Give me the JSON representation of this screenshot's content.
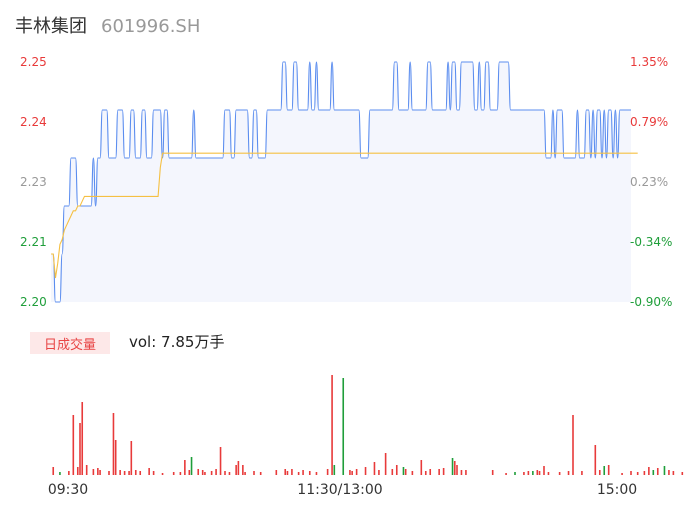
{
  "header": {
    "name": "丰林集团",
    "code": "601996.SH"
  },
  "volume_panel": {
    "tag": "日成交量",
    "label": "vol: 7.85万手"
  },
  "colors": {
    "price_line": "#5b8def",
    "avg_line": "#f5c043",
    "area_fill": "#f4f6fd",
    "up": "#e83a3a",
    "down": "#1f9e3a",
    "neutral": "#999999",
    "volume_up": "#f07878"
  },
  "chart_data": [
    {
      "type": "line",
      "title": "",
      "y_ticks_left": [
        "2.25",
        "2.24",
        "2.23",
        "2.21",
        "2.20"
      ],
      "y_ticks_right": [
        "1.35%",
        "0.79%",
        "0.23%",
        "-0.34%",
        "-0.90%"
      ],
      "ylim": [
        2.2,
        2.25
      ],
      "x_ticks": [
        "09:30",
        "11:30/13:00",
        "15:00"
      ],
      "series": [
        {
          "key": "price",
          "values": [
            2.21,
            2.21,
            2.2,
            2.2,
            2.2,
            2.21,
            2.22,
            2.22,
            2.22,
            2.23,
            2.23,
            2.23,
            2.22,
            2.22,
            2.22,
            2.22,
            2.22,
            2.22,
            2.22,
            2.23,
            2.22,
            2.23,
            2.23,
            2.24,
            2.24,
            2.24,
            2.23,
            2.23,
            2.23,
            2.23,
            2.24,
            2.24,
            2.24,
            2.23,
            2.23,
            2.23,
            2.24,
            2.24,
            2.23,
            2.23,
            2.23,
            2.24,
            2.24,
            2.23,
            2.23,
            2.23,
            2.24,
            2.24,
            2.24,
            2.24,
            2.23,
            2.24,
            2.24,
            2.23,
            2.23,
            2.23,
            2.23,
            2.23,
            2.23,
            2.23,
            2.23,
            2.23,
            2.23,
            2.23,
            2.24,
            2.23,
            2.23,
            2.23,
            2.23,
            2.23,
            2.23,
            2.23,
            2.23,
            2.23,
            2.23,
            2.23,
            2.23,
            2.23,
            2.24,
            2.24,
            2.24,
            2.23,
            2.23,
            2.24,
            2.24,
            2.24,
            2.24,
            2.24,
            2.24,
            2.23,
            2.23,
            2.24,
            2.24,
            2.23,
            2.23,
            2.23,
            2.23,
            2.24,
            2.24,
            2.24,
            2.24,
            2.24,
            2.24,
            2.24,
            2.25,
            2.25,
            2.24,
            2.24,
            2.24,
            2.25,
            2.25,
            2.24,
            2.24,
            2.24,
            2.24,
            2.24,
            2.25,
            2.24,
            2.24,
            2.25,
            2.24,
            2.24,
            2.24,
            2.24,
            2.24,
            2.24,
            2.25,
            2.24,
            2.24,
            2.24,
            2.24,
            2.24,
            2.24,
            2.24,
            2.24,
            2.24,
            2.24,
            2.24,
            2.24,
            2.23,
            2.23,
            2.23,
            2.23,
            2.24,
            2.24,
            2.24,
            2.24,
            2.24,
            2.24,
            2.24,
            2.24,
            2.24,
            2.24,
            2.24,
            2.25,
            2.25,
            2.24,
            2.24,
            2.24,
            2.24,
            2.24,
            2.25,
            2.24,
            2.24,
            2.24,
            2.24,
            2.24,
            2.24,
            2.24,
            2.25,
            2.25,
            2.24,
            2.24,
            2.24,
            2.24,
            2.24,
            2.24,
            2.24,
            2.25,
            2.24,
            2.25,
            2.25,
            2.24,
            2.24,
            2.25,
            2.25,
            2.25,
            2.25,
            2.25,
            2.25,
            2.24,
            2.24,
            2.25,
            2.24,
            2.24,
            2.25,
            2.25,
            2.24,
            2.24,
            2.24,
            2.24,
            2.25,
            2.25,
            2.25,
            2.25,
            2.25,
            2.24,
            2.24,
            2.24,
            2.24,
            2.24,
            2.24,
            2.24,
            2.24,
            2.24,
            2.24,
            2.24,
            2.24,
            2.24,
            2.24,
            2.24,
            2.24,
            2.23,
            2.23,
            2.23,
            2.24,
            2.23,
            2.24,
            2.24,
            2.24,
            2.23,
            2.23,
            2.23,
            2.23,
            2.23,
            2.23,
            2.24,
            2.23,
            2.23,
            2.23,
            2.24,
            2.24,
            2.23,
            2.24,
            2.23,
            2.24,
            2.24,
            2.23,
            2.24,
            2.23,
            2.24,
            2.24,
            2.23,
            2.24,
            2.23,
            2.24,
            2.24,
            2.24,
            2.24,
            2.24,
            2.24
          ]
        },
        {
          "key": "average",
          "values": [
            2.21,
            2.21,
            2.205,
            2.208,
            2.212,
            2.213,
            2.215,
            2.216,
            2.217,
            2.218,
            2.219,
            2.219,
            2.22,
            2.22,
            2.221,
            2.222,
            2.222,
            2.222,
            2.222,
            2.222,
            2.222,
            2.222,
            2.222,
            2.222,
            2.222,
            2.222,
            2.222,
            2.222,
            2.222,
            2.222,
            2.222,
            2.222,
            2.222,
            2.222,
            2.222,
            2.222,
            2.222,
            2.222,
            2.222,
            2.222,
            2.222,
            2.222,
            2.222,
            2.222,
            2.222,
            2.222,
            2.222,
            2.222,
            2.222,
            2.228,
            2.231,
            2.231,
            2.231,
            2.231,
            2.231,
            2.231,
            2.231,
            2.231,
            2.231,
            2.231,
            2.231,
            2.231,
            2.231,
            2.231,
            2.231,
            2.231,
            2.231,
            2.231,
            2.231,
            2.231,
            2.231,
            2.231,
            2.231,
            2.231,
            2.231,
            2.231,
            2.231,
            2.231,
            2.231,
            2.231,
            2.231,
            2.231,
            2.231,
            2.231,
            2.231,
            2.231,
            2.231,
            2.231,
            2.231,
            2.231,
            2.231,
            2.231,
            2.231,
            2.231,
            2.231,
            2.231,
            2.231,
            2.231,
            2.231,
            2.231,
            2.231,
            2.231,
            2.231,
            2.231,
            2.231,
            2.231,
            2.231,
            2.231,
            2.231,
            2.231,
            2.231,
            2.231,
            2.231,
            2.231,
            2.231,
            2.231,
            2.231,
            2.231,
            2.231,
            2.231,
            2.231,
            2.231,
            2.231,
            2.231,
            2.231,
            2.231,
            2.231,
            2.231,
            2.231,
            2.231,
            2.231,
            2.231,
            2.231,
            2.231,
            2.231,
            2.231,
            2.231,
            2.231,
            2.231,
            2.231,
            2.231,
            2.231,
            2.231,
            2.231,
            2.231,
            2.231,
            2.231,
            2.231,
            2.231,
            2.231,
            2.231,
            2.231,
            2.231,
            2.231,
            2.231,
            2.231,
            2.231,
            2.231,
            2.231,
            2.231,
            2.231,
            2.231,
            2.231,
            2.231,
            2.231,
            2.231,
            2.231,
            2.231,
            2.231,
            2.231,
            2.231,
            2.231,
            2.231,
            2.231,
            2.231,
            2.231,
            2.231,
            2.231,
            2.231,
            2.231,
            2.231,
            2.231,
            2.231,
            2.231,
            2.231,
            2.231,
            2.231,
            2.231,
            2.231,
            2.231,
            2.231,
            2.231,
            2.231,
            2.231,
            2.231,
            2.231,
            2.231,
            2.231,
            2.231,
            2.231,
            2.231,
            2.231,
            2.231,
            2.231,
            2.231,
            2.231,
            2.231,
            2.231,
            2.231,
            2.231,
            2.231,
            2.231,
            2.231,
            2.231,
            2.231,
            2.231,
            2.231,
            2.231,
            2.231,
            2.231,
            2.231,
            2.231,
            2.231,
            2.231,
            2.231,
            2.231,
            2.231,
            2.231,
            2.231,
            2.231,
            2.231,
            2.231,
            2.231,
            2.231,
            2.231,
            2.231,
            2.231,
            2.231,
            2.231,
            2.231,
            2.231,
            2.231,
            2.231,
            2.231,
            2.231,
            2.231,
            2.231,
            2.231,
            2.231,
            2.231,
            2.231,
            2.231,
            2.231,
            2.231,
            2.231,
            2.231,
            2.231,
            2.231,
            2.231,
            2.231,
            2.231,
            2.231,
            2.231,
            2.231
          ]
        }
      ]
    },
    {
      "type": "bar",
      "title": "",
      "volumes": [
        {
          "i": 1,
          "v": 8,
          "c": "up"
        },
        {
          "i": 4,
          "v": 3,
          "c": "down"
        },
        {
          "i": 8,
          "v": 4,
          "c": "up"
        },
        {
          "i": 10,
          "v": 60,
          "c": "up"
        },
        {
          "i": 12,
          "v": 8,
          "c": "up"
        },
        {
          "i": 13,
          "v": 52,
          "c": "up"
        },
        {
          "i": 14,
          "v": 73,
          "c": "up"
        },
        {
          "i": 16,
          "v": 10,
          "c": "up"
        },
        {
          "i": 19,
          "v": 6,
          "c": "up"
        },
        {
          "i": 21,
          "v": 7,
          "c": "up"
        },
        {
          "i": 22,
          "v": 5,
          "c": "up"
        },
        {
          "i": 26,
          "v": 4,
          "c": "up"
        },
        {
          "i": 28,
          "v": 62,
          "c": "up"
        },
        {
          "i": 29,
          "v": 35,
          "c": "up"
        },
        {
          "i": 31,
          "v": 5,
          "c": "up"
        },
        {
          "i": 33,
          "v": 4,
          "c": "up"
        },
        {
          "i": 35,
          "v": 4,
          "c": "up"
        },
        {
          "i": 36,
          "v": 34,
          "c": "up"
        },
        {
          "i": 38,
          "v": 5,
          "c": "up"
        },
        {
          "i": 40,
          "v": 4,
          "c": "up"
        },
        {
          "i": 44,
          "v": 7,
          "c": "up"
        },
        {
          "i": 46,
          "v": 4,
          "c": "up"
        },
        {
          "i": 50,
          "v": 2,
          "c": "up"
        },
        {
          "i": 55,
          "v": 3,
          "c": "up"
        },
        {
          "i": 58,
          "v": 3,
          "c": "up"
        },
        {
          "i": 60,
          "v": 15,
          "c": "up"
        },
        {
          "i": 62,
          "v": 5,
          "c": "up"
        },
        {
          "i": 63,
          "v": 18,
          "c": "down"
        },
        {
          "i": 66,
          "v": 6,
          "c": "up"
        },
        {
          "i": 68,
          "v": 5,
          "c": "up"
        },
        {
          "i": 69,
          "v": 3,
          "c": "up"
        },
        {
          "i": 72,
          "v": 4,
          "c": "up"
        },
        {
          "i": 74,
          "v": 6,
          "c": "up"
        },
        {
          "i": 76,
          "v": 28,
          "c": "up"
        },
        {
          "i": 78,
          "v": 4,
          "c": "up"
        },
        {
          "i": 80,
          "v": 3,
          "c": "up"
        },
        {
          "i": 83,
          "v": 10,
          "c": "up"
        },
        {
          "i": 84,
          "v": 14,
          "c": "up"
        },
        {
          "i": 86,
          "v": 10,
          "c": "up"
        },
        {
          "i": 87,
          "v": 3,
          "c": "up"
        },
        {
          "i": 91,
          "v": 4,
          "c": "up"
        },
        {
          "i": 94,
          "v": 3,
          "c": "up"
        },
        {
          "i": 101,
          "v": 5,
          "c": "up"
        },
        {
          "i": 105,
          "v": 6,
          "c": "up"
        },
        {
          "i": 106,
          "v": 4,
          "c": "up"
        },
        {
          "i": 108,
          "v": 6,
          "c": "up"
        },
        {
          "i": 111,
          "v": 3,
          "c": "up"
        },
        {
          "i": 113,
          "v": 5,
          "c": "up"
        },
        {
          "i": 116,
          "v": 4,
          "c": "up"
        },
        {
          "i": 119,
          "v": 3,
          "c": "up"
        },
        {
          "i": 124,
          "v": 6,
          "c": "up"
        },
        {
          "i": 126,
          "v": 100,
          "c": "up"
        },
        {
          "i": 127,
          "v": 10,
          "c": "down"
        },
        {
          "i": 131,
          "v": 97,
          "c": "down"
        },
        {
          "i": 134,
          "v": 5,
          "c": "up"
        },
        {
          "i": 135,
          "v": 4,
          "c": "up"
        },
        {
          "i": 137,
          "v": 6,
          "c": "up"
        },
        {
          "i": 141,
          "v": 8,
          "c": "up"
        },
        {
          "i": 145,
          "v": 13,
          "c": "up"
        },
        {
          "i": 147,
          "v": 5,
          "c": "up"
        },
        {
          "i": 150,
          "v": 22,
          "c": "up"
        },
        {
          "i": 153,
          "v": 6,
          "c": "up"
        },
        {
          "i": 155,
          "v": 10,
          "c": "up"
        },
        {
          "i": 158,
          "v": 8,
          "c": "down"
        },
        {
          "i": 159,
          "v": 6,
          "c": "up"
        },
        {
          "i": 162,
          "v": 4,
          "c": "up"
        },
        {
          "i": 166,
          "v": 15,
          "c": "up"
        },
        {
          "i": 168,
          "v": 4,
          "c": "up"
        },
        {
          "i": 170,
          "v": 6,
          "c": "up"
        },
        {
          "i": 174,
          "v": 6,
          "c": "up"
        },
        {
          "i": 176,
          "v": 7,
          "c": "up"
        },
        {
          "i": 180,
          "v": 17,
          "c": "down"
        },
        {
          "i": 181,
          "v": 14,
          "c": "up"
        },
        {
          "i": 182,
          "v": 10,
          "c": "up"
        },
        {
          "i": 184,
          "v": 5,
          "c": "up"
        },
        {
          "i": 186,
          "v": 5,
          "c": "up"
        },
        {
          "i": 198,
          "v": 5,
          "c": "up"
        },
        {
          "i": 204,
          "v": 2,
          "c": "up"
        },
        {
          "i": 208,
          "v": 3,
          "c": "down"
        },
        {
          "i": 212,
          "v": 3,
          "c": "up"
        },
        {
          "i": 214,
          "v": 4,
          "c": "up"
        },
        {
          "i": 216,
          "v": 4,
          "c": "down"
        },
        {
          "i": 218,
          "v": 5,
          "c": "up"
        },
        {
          "i": 219,
          "v": 4,
          "c": "up"
        },
        {
          "i": 221,
          "v": 9,
          "c": "up"
        },
        {
          "i": 223,
          "v": 3,
          "c": "up"
        },
        {
          "i": 228,
          "v": 3,
          "c": "up"
        },
        {
          "i": 232,
          "v": 4,
          "c": "up"
        },
        {
          "i": 234,
          "v": 60,
          "c": "up"
        },
        {
          "i": 238,
          "v": 4,
          "c": "up"
        },
        {
          "i": 244,
          "v": 30,
          "c": "up"
        },
        {
          "i": 246,
          "v": 5,
          "c": "up"
        },
        {
          "i": 248,
          "v": 9,
          "c": "down"
        },
        {
          "i": 250,
          "v": 10,
          "c": "up"
        },
        {
          "i": 256,
          "v": 2,
          "c": "up"
        },
        {
          "i": 260,
          "v": 4,
          "c": "up"
        },
        {
          "i": 263,
          "v": 3,
          "c": "up"
        },
        {
          "i": 266,
          "v": 4,
          "c": "up"
        },
        {
          "i": 268,
          "v": 8,
          "c": "up"
        },
        {
          "i": 270,
          "v": 5,
          "c": "down"
        },
        {
          "i": 272,
          "v": 7,
          "c": "up"
        },
        {
          "i": 275,
          "v": 9,
          "c": "down"
        },
        {
          "i": 277,
          "v": 5,
          "c": "up"
        },
        {
          "i": 279,
          "v": 4,
          "c": "up"
        },
        {
          "i": 283,
          "v": 3,
          "c": "up"
        },
        {
          "i": 286,
          "v": 4,
          "c": "up"
        },
        {
          "i": 289,
          "v": 4,
          "c": "up"
        },
        {
          "i": 291,
          "v": 5,
          "c": "up"
        },
        {
          "i": 293,
          "v": 3,
          "c": "down"
        },
        {
          "i": 295,
          "v": 5,
          "c": "up"
        },
        {
          "i": 297,
          "v": 11,
          "c": "up"
        },
        {
          "i": 299,
          "v": 72,
          "c": "up"
        },
        {
          "i": 300,
          "v": 6,
          "c": "up"
        },
        {
          "i": 302,
          "v": 33,
          "c": "vup"
        }
      ]
    }
  ]
}
